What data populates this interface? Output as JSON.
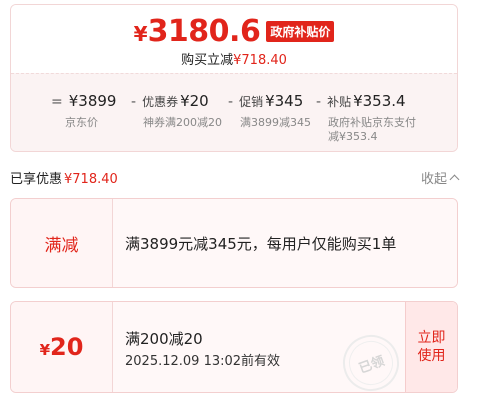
{
  "summary": {
    "currency": "¥",
    "final_price": "3180.6",
    "gov_badge": "政府补贴价",
    "cut_label": "购买立减",
    "cut_amount": "¥718.40",
    "breakdown": [
      {
        "op": "=",
        "label": "",
        "amount": "¥3899",
        "sub": [
          "京东价"
        ]
      },
      {
        "op": "-",
        "label": "优惠券",
        "amount": "¥20",
        "sub": [
          "神券满200减20"
        ]
      },
      {
        "op": "-",
        "label": "促销",
        "amount": "¥345",
        "sub": [
          "满3899减345"
        ]
      },
      {
        "op": "-",
        "label": "补贴",
        "amount": "¥353.4",
        "sub": [
          "政府补贴京东支付",
          "减¥353.4"
        ]
      }
    ]
  },
  "enjoyed": {
    "label": "已享优惠",
    "amount": "¥718.40",
    "collapse_label": "收起"
  },
  "promotions": {
    "full_reduction": {
      "tag": "满减",
      "description": "满3899元减345元，每用户仅能购买1单"
    },
    "coupon": {
      "currency": "¥",
      "value": "20",
      "title": "满200减20",
      "expiry": "2025.12.09 13:02前有效",
      "action_line1": "立即",
      "action_line2": "使用",
      "stamp_text": "已领"
    }
  },
  "colors": {
    "accent": "#e1251b",
    "card_border": "#f3cfcf",
    "card_bg": "#fff8f8"
  }
}
